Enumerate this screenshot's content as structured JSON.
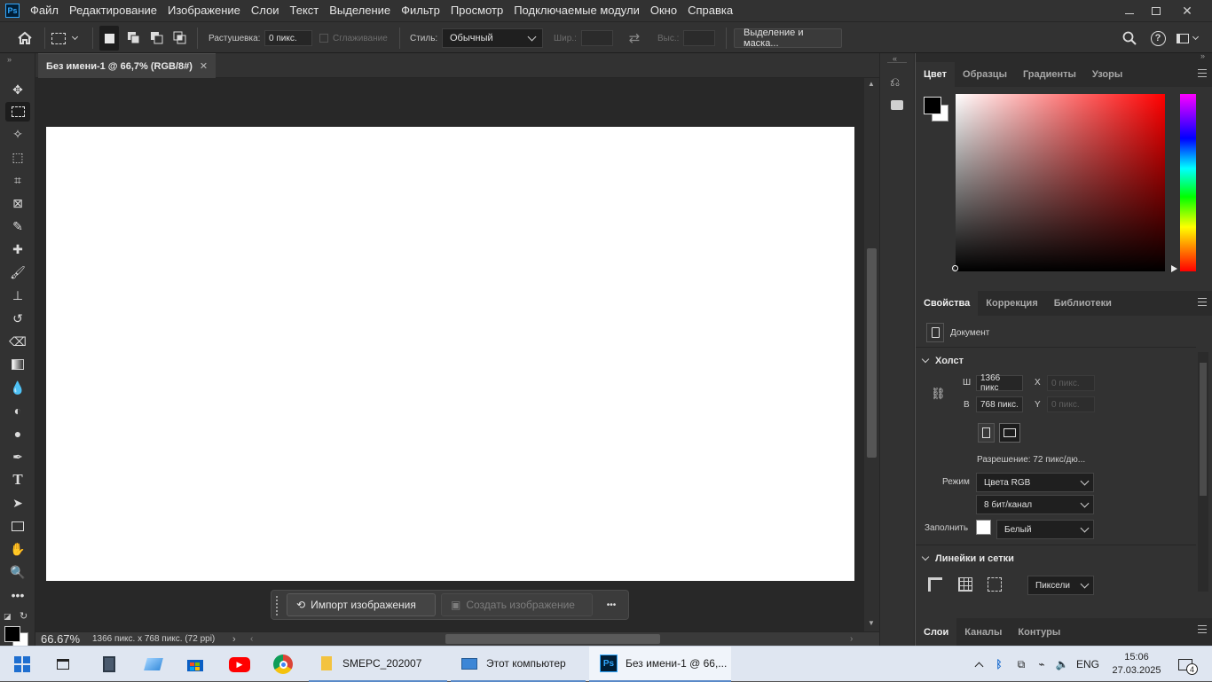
{
  "app": {
    "logo": "Ps"
  },
  "menu": [
    "Файл",
    "Редактирование",
    "Изображение",
    "Слои",
    "Текст",
    "Выделение",
    "Фильтр",
    "Просмотр",
    "Подключаемые модули",
    "Окно",
    "Справка"
  ],
  "options": {
    "feather_label": "Растушевка:",
    "feather_value": "0 пикс.",
    "antialias_label": "Сглаживание",
    "style_label": "Стиль:",
    "style_value": "Обычный",
    "width_label": "Шир.:",
    "height_label": "Выс.:",
    "select_mask_label": "Выделение и маска..."
  },
  "document": {
    "tab_title": "Без имени-1 @ 66,7% (RGB/8#)",
    "zoom": "66.67%",
    "info": "1366 пикс. x 768 пикс. (72 ppi)"
  },
  "context_bar": {
    "import_label": "Импорт изображения",
    "generate_label": "Создать изображение",
    "more_label": "•••"
  },
  "color_panel": {
    "tabs": [
      "Цвет",
      "Образцы",
      "Градиенты",
      "Узоры"
    ],
    "foreground": "#000000",
    "background": "#ffffff",
    "hue_color": "#ff0000"
  },
  "properties_panel": {
    "tabs": [
      "Свойства",
      "Коррекция",
      "Библиотеки"
    ],
    "doc_label": "Документ",
    "canvas_section": "Холст",
    "w_label": "Ш",
    "w_value": "1366 пикс",
    "h_label": "В",
    "h_value": "768 пикс.",
    "x_label": "X",
    "x_placeholder": "0 пикс.",
    "y_label": "Y",
    "y_placeholder": "0 пикс.",
    "resolution": "Разрешение: 72 пикс/дю...",
    "mode_label": "Режим",
    "mode_value": "Цвета RGB",
    "depth_value": "8 бит/канал",
    "fill_label": "Заполнить",
    "fill_value": "Белый",
    "rulers_section": "Линейки и сетки",
    "units_value": "Пиксели"
  },
  "layers_panel": {
    "tabs": [
      "Слои",
      "Каналы",
      "Контуры"
    ]
  },
  "taskbar": {
    "folder_label": "SMEPC_202007",
    "computer_label": "Этот компьютер",
    "ps_label": "Без имени-1 @ 66,...",
    "lang": "ENG",
    "time": "15:06",
    "date": "27.03.2025",
    "notifications": "4"
  }
}
